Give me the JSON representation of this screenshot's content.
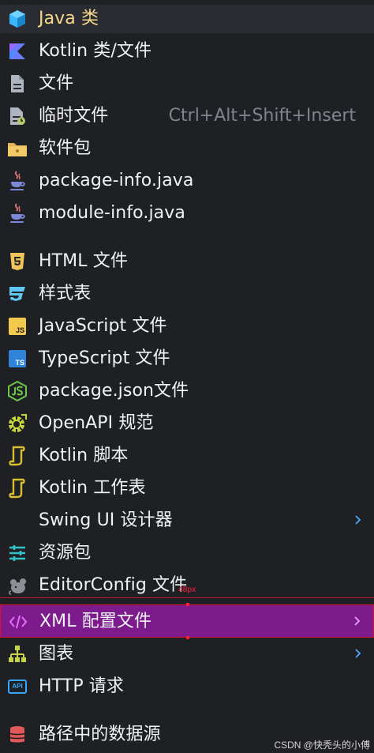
{
  "menu": {
    "items": [
      {
        "label": "Java 类",
        "icon": "java-class-icon"
      },
      {
        "label": "Kotlin 类/文件",
        "icon": "kotlin-icon"
      },
      {
        "label": "文件",
        "icon": "file-icon"
      },
      {
        "label": "临时文件",
        "icon": "scratch-file-icon",
        "shortcut": "Ctrl+Alt+Shift+Insert"
      },
      {
        "label": "软件包",
        "icon": "package-folder-icon"
      },
      {
        "label": "package-info.java",
        "icon": "java-cup-icon"
      },
      {
        "label": "module-info.java",
        "icon": "java-cup-icon"
      },
      {
        "label": "HTML 文件",
        "icon": "html5-icon"
      },
      {
        "label": "样式表",
        "icon": "css-icon"
      },
      {
        "label": "JavaScript 文件",
        "icon": "javascript-icon"
      },
      {
        "label": "TypeScript 文件",
        "icon": "typescript-icon"
      },
      {
        "label": "package.json文件",
        "icon": "nodejs-icon"
      },
      {
        "label": "OpenAPI 规范",
        "icon": "openapi-icon"
      },
      {
        "label": "Kotlin 脚本",
        "icon": "kotlin-script-icon"
      },
      {
        "label": "Kotlin 工作表",
        "icon": "kotlin-worksheet-icon"
      },
      {
        "label": "Swing UI 设计器",
        "icon": "",
        "submenu": true
      },
      {
        "label": "资源包",
        "icon": "resource-bundle-icon"
      },
      {
        "label": "EditorConfig 文件",
        "icon": "editorconfig-mouse-icon"
      },
      {
        "label": "XML 配置文件",
        "icon": "xml-code-icon",
        "submenu": true,
        "selected": true
      },
      {
        "label": "图表",
        "icon": "diagram-icon",
        "submenu": true
      },
      {
        "label": "HTTP 请求",
        "icon": "api-icon"
      },
      {
        "label": "路径中的数据源",
        "icon": "database-icon"
      }
    ],
    "api_badge": "API",
    "js_badge": "JS",
    "ts_badge": "TS",
    "measure_label": "48px"
  },
  "watermark": "CSDN @快秃头的小傅",
  "colors": {
    "background": "#1f2023",
    "selected": "#7d1b8d",
    "shortcut_text": "#7e848d",
    "accent_blue": "#37a6ff",
    "kotlin_yellow": "#d7bf2d"
  }
}
